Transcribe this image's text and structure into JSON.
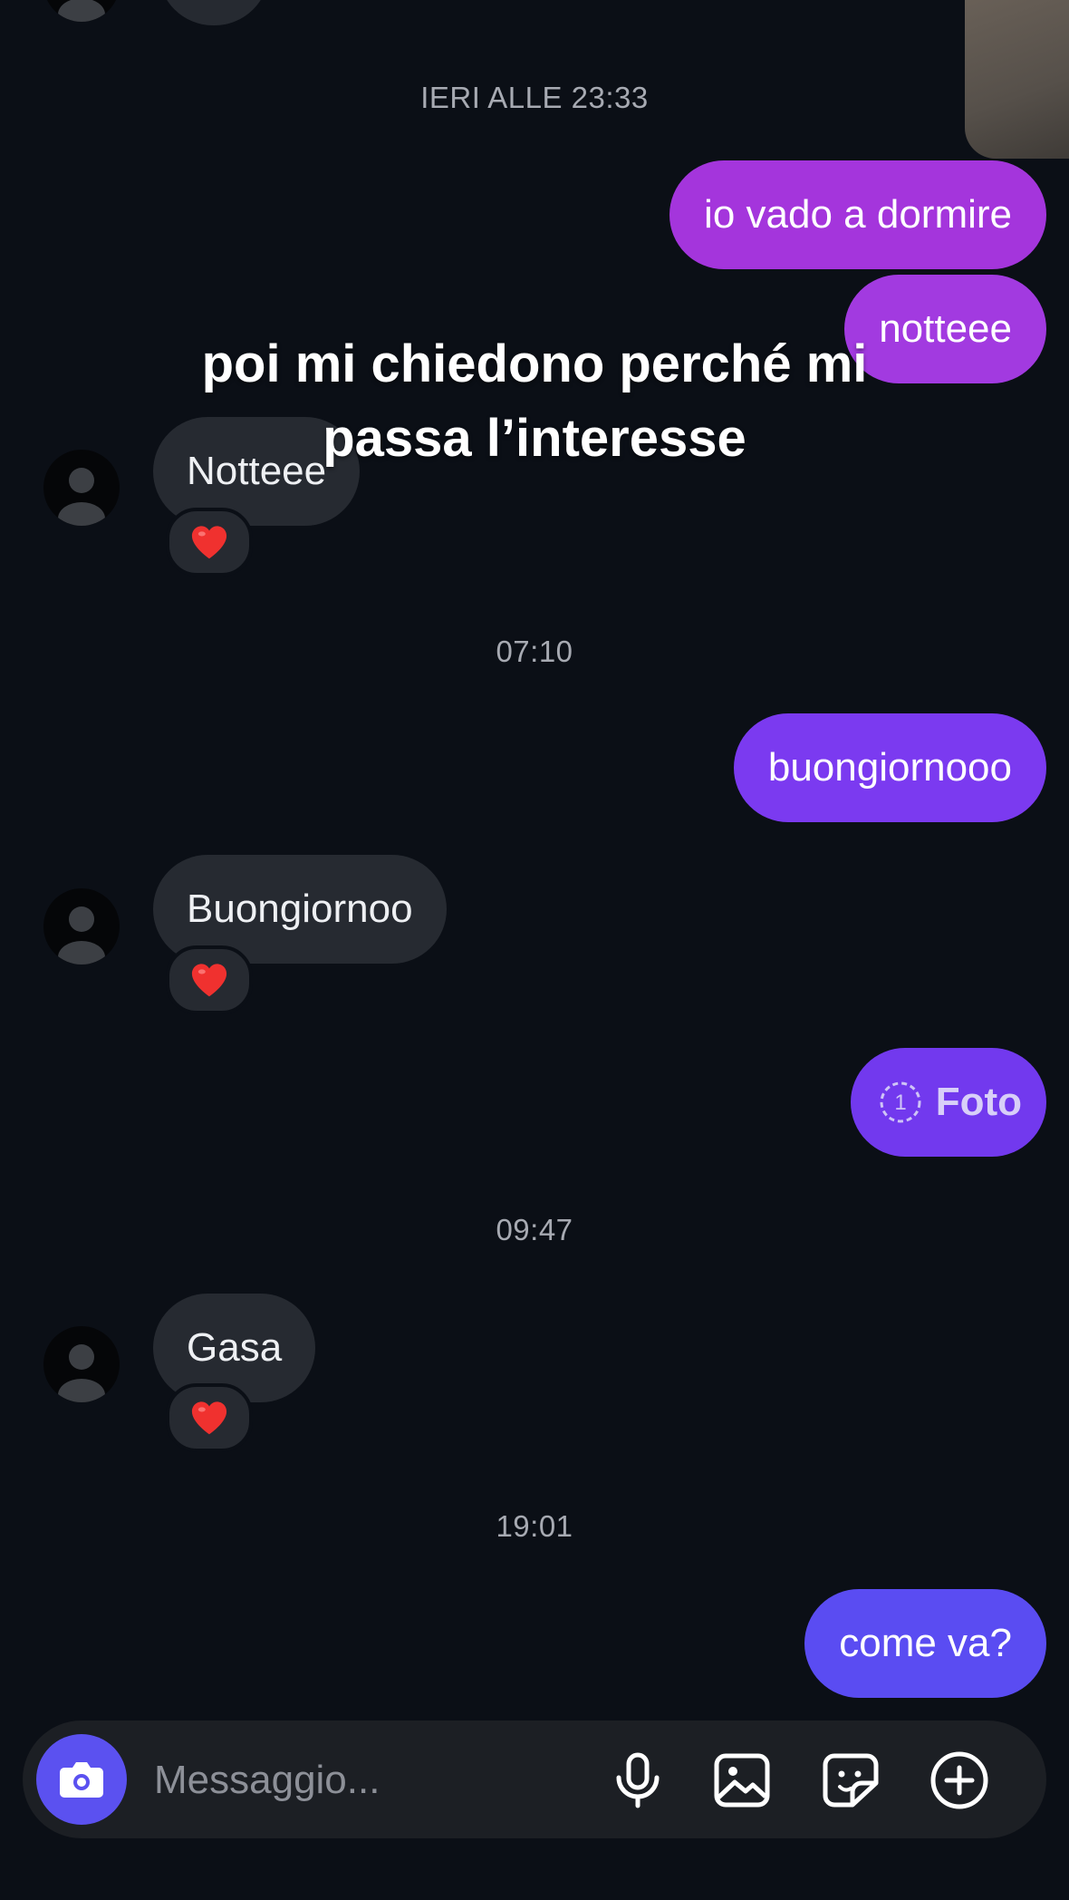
{
  "header": {
    "time_separator": "IERI ALLE 23:33"
  },
  "overlay": {
    "caption": "poi mi chiedono perché mi passa l’interesse"
  },
  "messages": [
    {
      "text": "io vado a dormire"
    },
    {
      "text": "notteee"
    },
    {
      "text": "Notteee",
      "reaction": "❤️"
    },
    {
      "time": "07:10"
    },
    {
      "text": "buongiornooo"
    },
    {
      "text": "Buongiornoo",
      "reaction": "❤️"
    },
    {
      "text": "Foto",
      "badge": "1"
    },
    {
      "time": "09:47"
    },
    {
      "text": "Gasa",
      "reaction": "❤️"
    },
    {
      "time": "19:01"
    },
    {
      "text": "come va?"
    }
  ],
  "composer": {
    "placeholder": "Messaggio..."
  },
  "colors": {
    "background": "#0b0f16",
    "incoming_bubble": "#262a31",
    "outgoing_top": "#a435dc",
    "outgoing_mid": "#7b3af0",
    "outgoing_bottom": "#5a4cf2",
    "camera_button": "#5b51f0"
  },
  "icons": {
    "camera": "camera-icon",
    "mic": "microphone-icon",
    "gallery": "image-icon",
    "sticker": "sticker-icon",
    "plus": "plus-circle-icon"
  }
}
